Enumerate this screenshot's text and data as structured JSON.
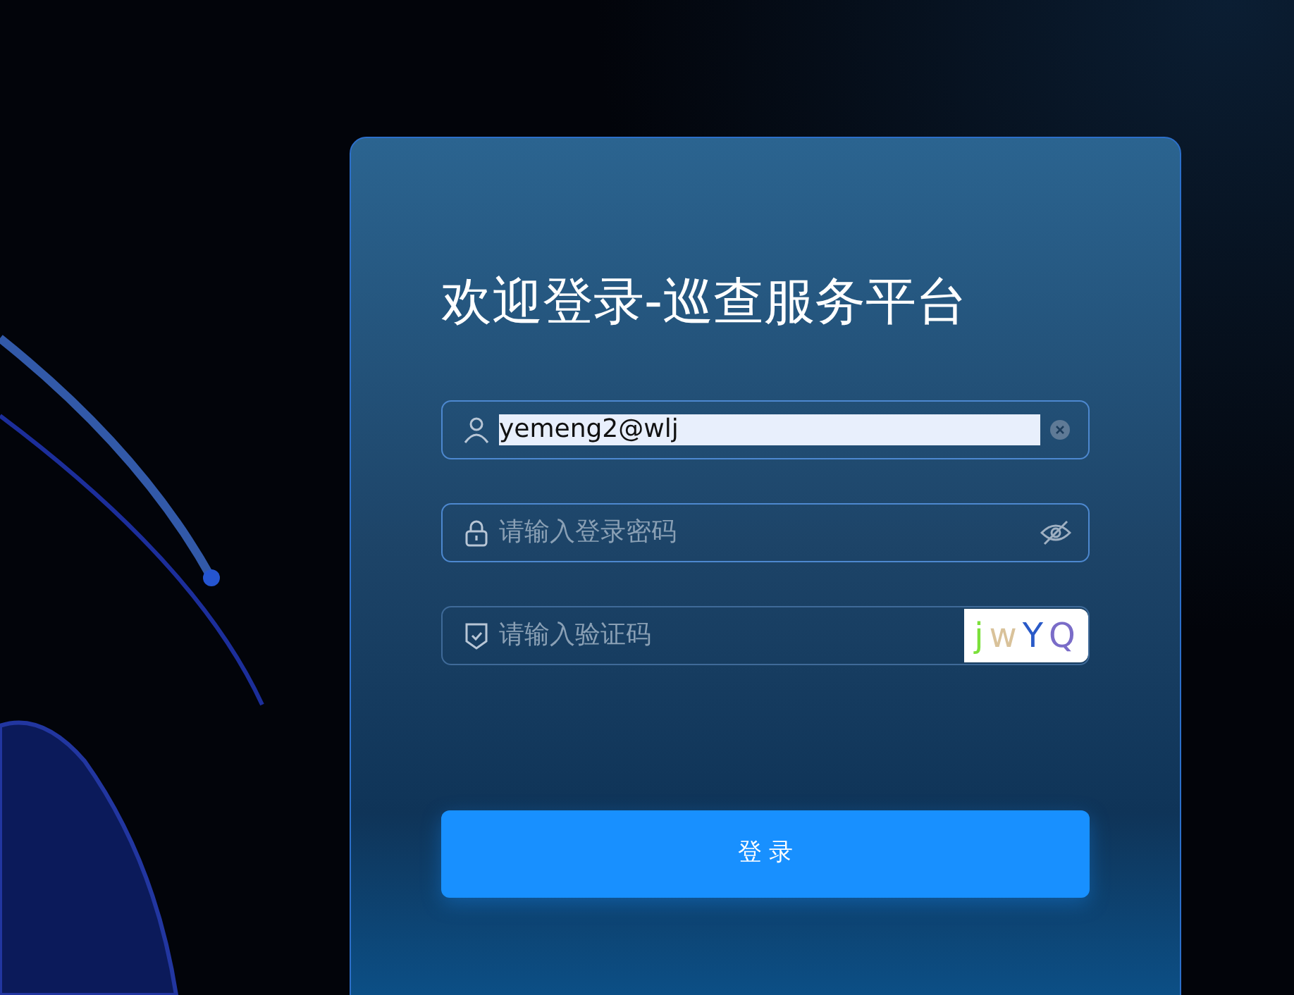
{
  "login_card": {
    "title": "欢迎登录-巡查服务平台",
    "username": {
      "value": "yemeng2@wlj",
      "selected": true
    },
    "password": {
      "placeholder": "请输入登录密码"
    },
    "captcha_field": {
      "placeholder": "请输入验证码"
    },
    "captcha_image": {
      "text": "jwYQ"
    },
    "submit_button": "登 录"
  }
}
